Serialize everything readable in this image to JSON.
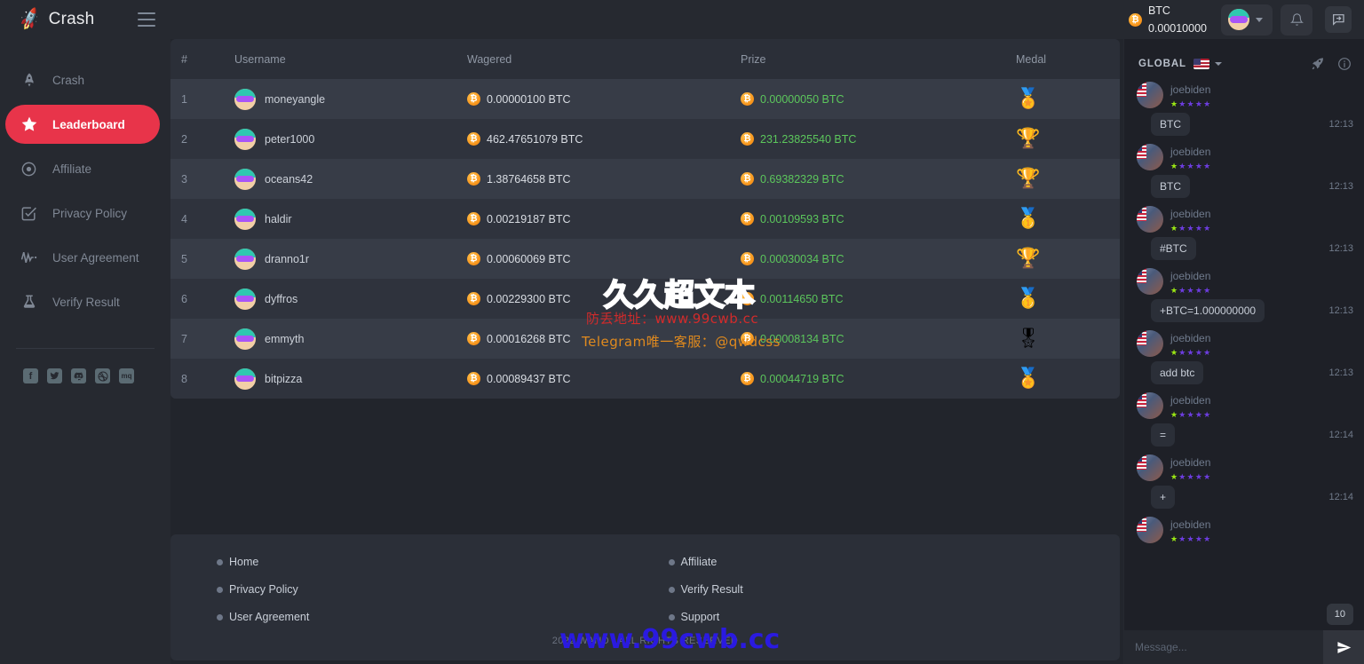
{
  "brand": {
    "logo_icon": "rocket-icon",
    "name": "Crash"
  },
  "topbar": {
    "menu_icon": "hamburger-icon",
    "balance": {
      "coin_icon": "btc-coin-icon",
      "currency": "BTC",
      "amount": "0.00010000"
    },
    "avatar_icon": "user-avatar",
    "avatar_caret_icon": "chevron-down-icon",
    "bell_icon": "bell-icon",
    "chat_toggle_icon": "chat-toggle-icon"
  },
  "sidebar": {
    "items": [
      {
        "label": "Crash",
        "icon": "rocket-icon",
        "active": false
      },
      {
        "label": "Leaderboard",
        "icon": "star-icon",
        "active": true
      },
      {
        "label": "Affiliate",
        "icon": "target-icon",
        "active": false
      },
      {
        "label": "Privacy Policy",
        "icon": "checkbox-icon",
        "active": false
      },
      {
        "label": "User Agreement",
        "icon": "pulse-icon",
        "active": false
      },
      {
        "label": "Verify Result",
        "icon": "flask-icon",
        "active": false
      }
    ],
    "socials": [
      {
        "name": "facebook-icon",
        "glyph": "f"
      },
      {
        "name": "twitter-icon",
        "glyph": "t"
      },
      {
        "name": "discord-icon",
        "glyph": "d"
      },
      {
        "name": "dribbble-icon",
        "glyph": "o"
      },
      {
        "name": "mq-icon",
        "glyph": "mq"
      }
    ]
  },
  "leaderboard": {
    "columns": [
      "#",
      "Username",
      "Wagered",
      "Prize",
      "Medal"
    ],
    "rows": [
      {
        "rank": "1",
        "username": "moneyangle",
        "wagered": "0.00000100 BTC",
        "prize": "0.00000050 BTC",
        "medal": "🏅"
      },
      {
        "rank": "2",
        "username": "peter1000",
        "wagered": "462.47651079 BTC",
        "prize": "231.23825540 BTC",
        "medal": "🏆"
      },
      {
        "rank": "3",
        "username": "oceans42",
        "wagered": "1.38764658 BTC",
        "prize": "0.69382329 BTC",
        "medal": "🏆"
      },
      {
        "rank": "4",
        "username": "haldir",
        "wagered": "0.00219187 BTC",
        "prize": "0.00109593 BTC",
        "medal": "🥇"
      },
      {
        "rank": "5",
        "username": "dranno1r",
        "wagered": "0.00060069 BTC",
        "prize": "0.00030034 BTC",
        "medal": "🏆"
      },
      {
        "rank": "6",
        "username": "dyffros",
        "wagered": "0.00229300 BTC",
        "prize": "0.00114650 BTC",
        "medal": "🥇"
      },
      {
        "rank": "7",
        "username": "emmyth",
        "wagered": "0.00016268 BTC",
        "prize": "0.00008134 BTC",
        "medal": "🎖"
      },
      {
        "rank": "8",
        "username": "bitpizza",
        "wagered": "0.00089437 BTC",
        "prize": "0.00044719 BTC",
        "medal": "🏅"
      }
    ]
  },
  "footer": {
    "col1": [
      "Home",
      "Privacy Policy",
      "User Agreement"
    ],
    "col2": [
      "Affiliate",
      "Verify Result",
      "Support"
    ],
    "copyright": "2022 WAND - ALL RIGHTS RESERVED"
  },
  "chat": {
    "title": "GLOBAL",
    "flag_icon": "us-flag-icon",
    "caret_icon": "chevron-down-icon",
    "rocket_icon": "rocket-icon",
    "info_icon": "info-icon",
    "unread_badge": "10",
    "input_placeholder": "Message...",
    "send_icon": "send-icon",
    "messages": [
      {
        "user": "joebiden",
        "text": "BTC",
        "time": "12:13"
      },
      {
        "user": "joebiden",
        "text": "BTC",
        "time": "12:13"
      },
      {
        "user": "joebiden",
        "text": "#BTC",
        "time": "12:13"
      },
      {
        "user": "joebiden",
        "text": "+BTC=1.000000000",
        "time": "12:13"
      },
      {
        "user": "joebiden",
        "text": "add btc",
        "time": "12:13"
      },
      {
        "user": "joebiden",
        "text": "=",
        "time": "12:14"
      },
      {
        "user": "joebiden",
        "text": "+",
        "time": "12:14"
      },
      {
        "user": "joebiden",
        "text": "",
        "time": ""
      }
    ]
  },
  "watermarks": {
    "line1": "久久超文本",
    "line2": "防丢地址：www.99cwb.cc",
    "line3": "Telegram唯一客服：@qwdcss",
    "line4": "www.99cwb.cc"
  },
  "colors": {
    "accent": "#e8344a",
    "prize_green": "#5cc75c",
    "btc_orange": "#f7931a",
    "bg": "#22252c",
    "panel": "#2b2f38"
  }
}
